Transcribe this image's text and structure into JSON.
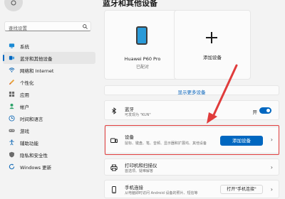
{
  "sidebar": {
    "search_placeholder": "查找设置",
    "items": [
      {
        "label": "系统",
        "icon": "monitor-icon"
      },
      {
        "label": "蓝牙和其他设备",
        "icon": "bluetooth-devices-icon",
        "active": true
      },
      {
        "label": "网络和 Internet",
        "icon": "network-icon"
      },
      {
        "label": "个性化",
        "icon": "brush-icon"
      },
      {
        "label": "应用",
        "icon": "apps-icon"
      },
      {
        "label": "帐户",
        "icon": "account-icon"
      },
      {
        "label": "时间和语言",
        "icon": "clock-language-icon"
      },
      {
        "label": "游戏",
        "icon": "gamepad-icon"
      },
      {
        "label": "辅助功能",
        "icon": "accessibility-icon"
      },
      {
        "label": "隐私和安全性",
        "icon": "shield-icon"
      },
      {
        "label": "Windows 更新",
        "icon": "update-icon"
      }
    ]
  },
  "main": {
    "title": "蓝牙和其他设备",
    "device_card": {
      "name": "Huawei P60 Pro",
      "status": "已配对"
    },
    "add_card": {
      "label": "添加设备"
    },
    "show_more": "显示更多设备",
    "bluetooth": {
      "title": "蓝牙",
      "subtitle": "可发现为 \"KUN\"",
      "toggle_label": "开"
    },
    "devices": {
      "title": "设备",
      "subtitle": "鼠标、键盘、笔、音频、显示器和扩展坞、其他设备",
      "button": "添加设备"
    },
    "printers": {
      "title": "打印机和扫描仪",
      "subtitle": "首选项、疑难解答"
    },
    "phone_link": {
      "title": "手机连接",
      "subtitle": "从电脑即时访问 Android 设备的照片、短信等",
      "button": "打开\"手机连接\""
    }
  },
  "colors": {
    "accent": "#0067c0",
    "annotation": "#e03c3c",
    "background": "#f3f3f3"
  }
}
